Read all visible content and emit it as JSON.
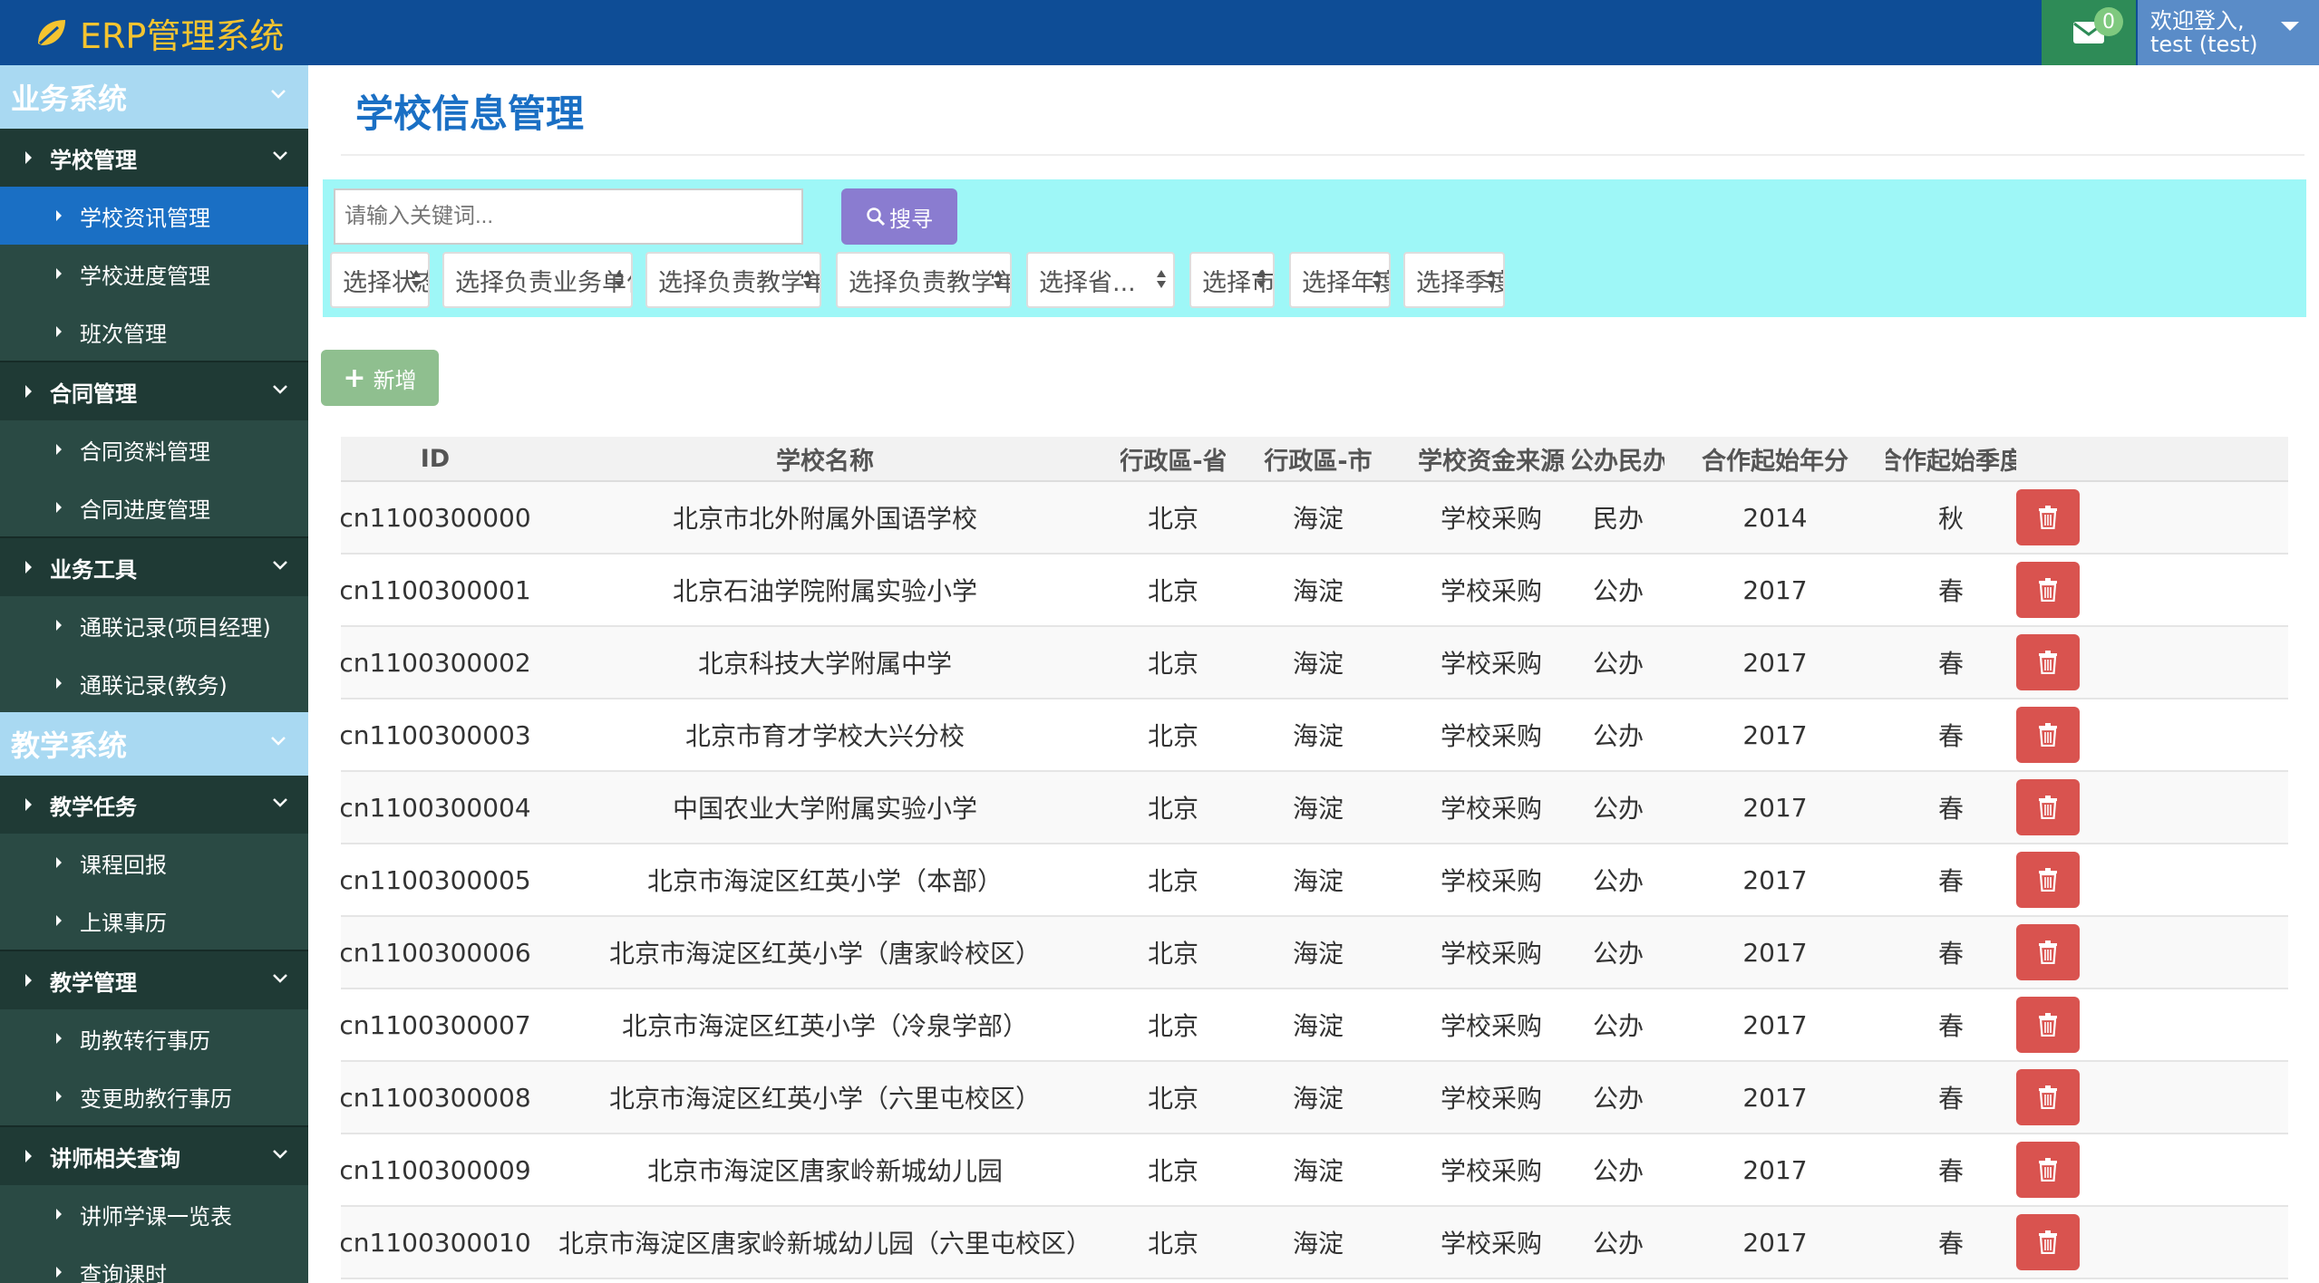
{
  "app": {
    "title": "ERP管理系统"
  },
  "header": {
    "mail_count": "0",
    "welcome": "欢迎登入,",
    "user": "test (test)"
  },
  "sidebar": {
    "systems": [
      {
        "label": "业务系统",
        "groups": [
          {
            "label": "学校管理",
            "items": [
              "学校资讯管理",
              "学校进度管理",
              "班次管理"
            ]
          },
          {
            "label": "合同管理",
            "items": [
              "合同资料管理",
              "合同进度管理"
            ]
          },
          {
            "label": "业务工具",
            "items": [
              "通联记录(项目经理)",
              "通联记录(教务)"
            ]
          }
        ]
      },
      {
        "label": "教学系统",
        "groups": [
          {
            "label": "教学任务",
            "items": [
              "课程回报",
              "上课事历"
            ]
          },
          {
            "label": "教学管理",
            "items": [
              "助教转行事历",
              "变更助教行事历"
            ]
          },
          {
            "label": "讲师相关查询",
            "items": [
              "讲师学课一览表",
              "查询课时"
            ]
          }
        ]
      }
    ],
    "active_item": "学校资讯管理"
  },
  "main": {
    "title": "学校信息管理",
    "search": {
      "placeholder": "请输入关键词...",
      "button": "搜寻"
    },
    "filters": [
      "选择状态...",
      "选择负责业务单位(处)...",
      "选择负责教学单位(处)",
      "选择负责教学单位(组)",
      "选择省...",
      "选择市...",
      "选择年度...",
      "选择季度..."
    ],
    "add_button": "新增",
    "table": {
      "columns": [
        "ID",
        "学校名称",
        "行政區-省",
        "行政區-市",
        "学校资金来源",
        "公办民办",
        "合作起始年分",
        "合作起始季度"
      ],
      "rows": [
        [
          "cn1100300000",
          "北京市北外附属外国语学校",
          "北京",
          "海淀",
          "学校采购",
          "民办",
          "2014",
          "秋"
        ],
        [
          "cn1100300001",
          "北京石油学院附属实验小学",
          "北京",
          "海淀",
          "学校采购",
          "公办",
          "2017",
          "春"
        ],
        [
          "cn1100300002",
          "北京科技大学附属中学",
          "北京",
          "海淀",
          "学校采购",
          "公办",
          "2017",
          "春"
        ],
        [
          "cn1100300003",
          "北京市育才学校大兴分校",
          "北京",
          "海淀",
          "学校采购",
          "公办",
          "2017",
          "春"
        ],
        [
          "cn1100300004",
          "中国农业大学附属实验小学",
          "北京",
          "海淀",
          "学校采购",
          "公办",
          "2017",
          "春"
        ],
        [
          "cn1100300005",
          "北京市海淀区红英小学（本部）",
          "北京",
          "海淀",
          "学校采购",
          "公办",
          "2017",
          "春"
        ],
        [
          "cn1100300006",
          "北京市海淀区红英小学（唐家岭校区）",
          "北京",
          "海淀",
          "学校采购",
          "公办",
          "2017",
          "春"
        ],
        [
          "cn1100300007",
          "北京市海淀区红英小学（冷泉学部）",
          "北京",
          "海淀",
          "学校采购",
          "公办",
          "2017",
          "春"
        ],
        [
          "cn1100300008",
          "北京市海淀区红英小学（六里屯校区）",
          "北京",
          "海淀",
          "学校采购",
          "公办",
          "2017",
          "春"
        ],
        [
          "cn1100300009",
          "北京市海淀区唐家岭新城幼儿园",
          "北京",
          "海淀",
          "学校采购",
          "公办",
          "2017",
          "春"
        ],
        [
          "cn1100300010",
          "北京市海淀区唐家岭新城幼儿园（六里屯校区）",
          "北京",
          "海淀",
          "学校采购",
          "公办",
          "2017",
          "春"
        ]
      ]
    }
  },
  "colors": {
    "topbar": "#0e4d96",
    "brand": "#f4c430",
    "sidebar": "#1f3a35",
    "active": "#1a6fc4",
    "filter_panel": "#9ef7f7",
    "delete": "#d9534f",
    "add": "#8fbf8f",
    "search": "#8a7cd0"
  },
  "icons": [
    "leaf-icon",
    "envelope-icon",
    "caret-down-icon",
    "chevron-down-icon",
    "search-icon",
    "plus-icon",
    "trash-icon"
  ]
}
